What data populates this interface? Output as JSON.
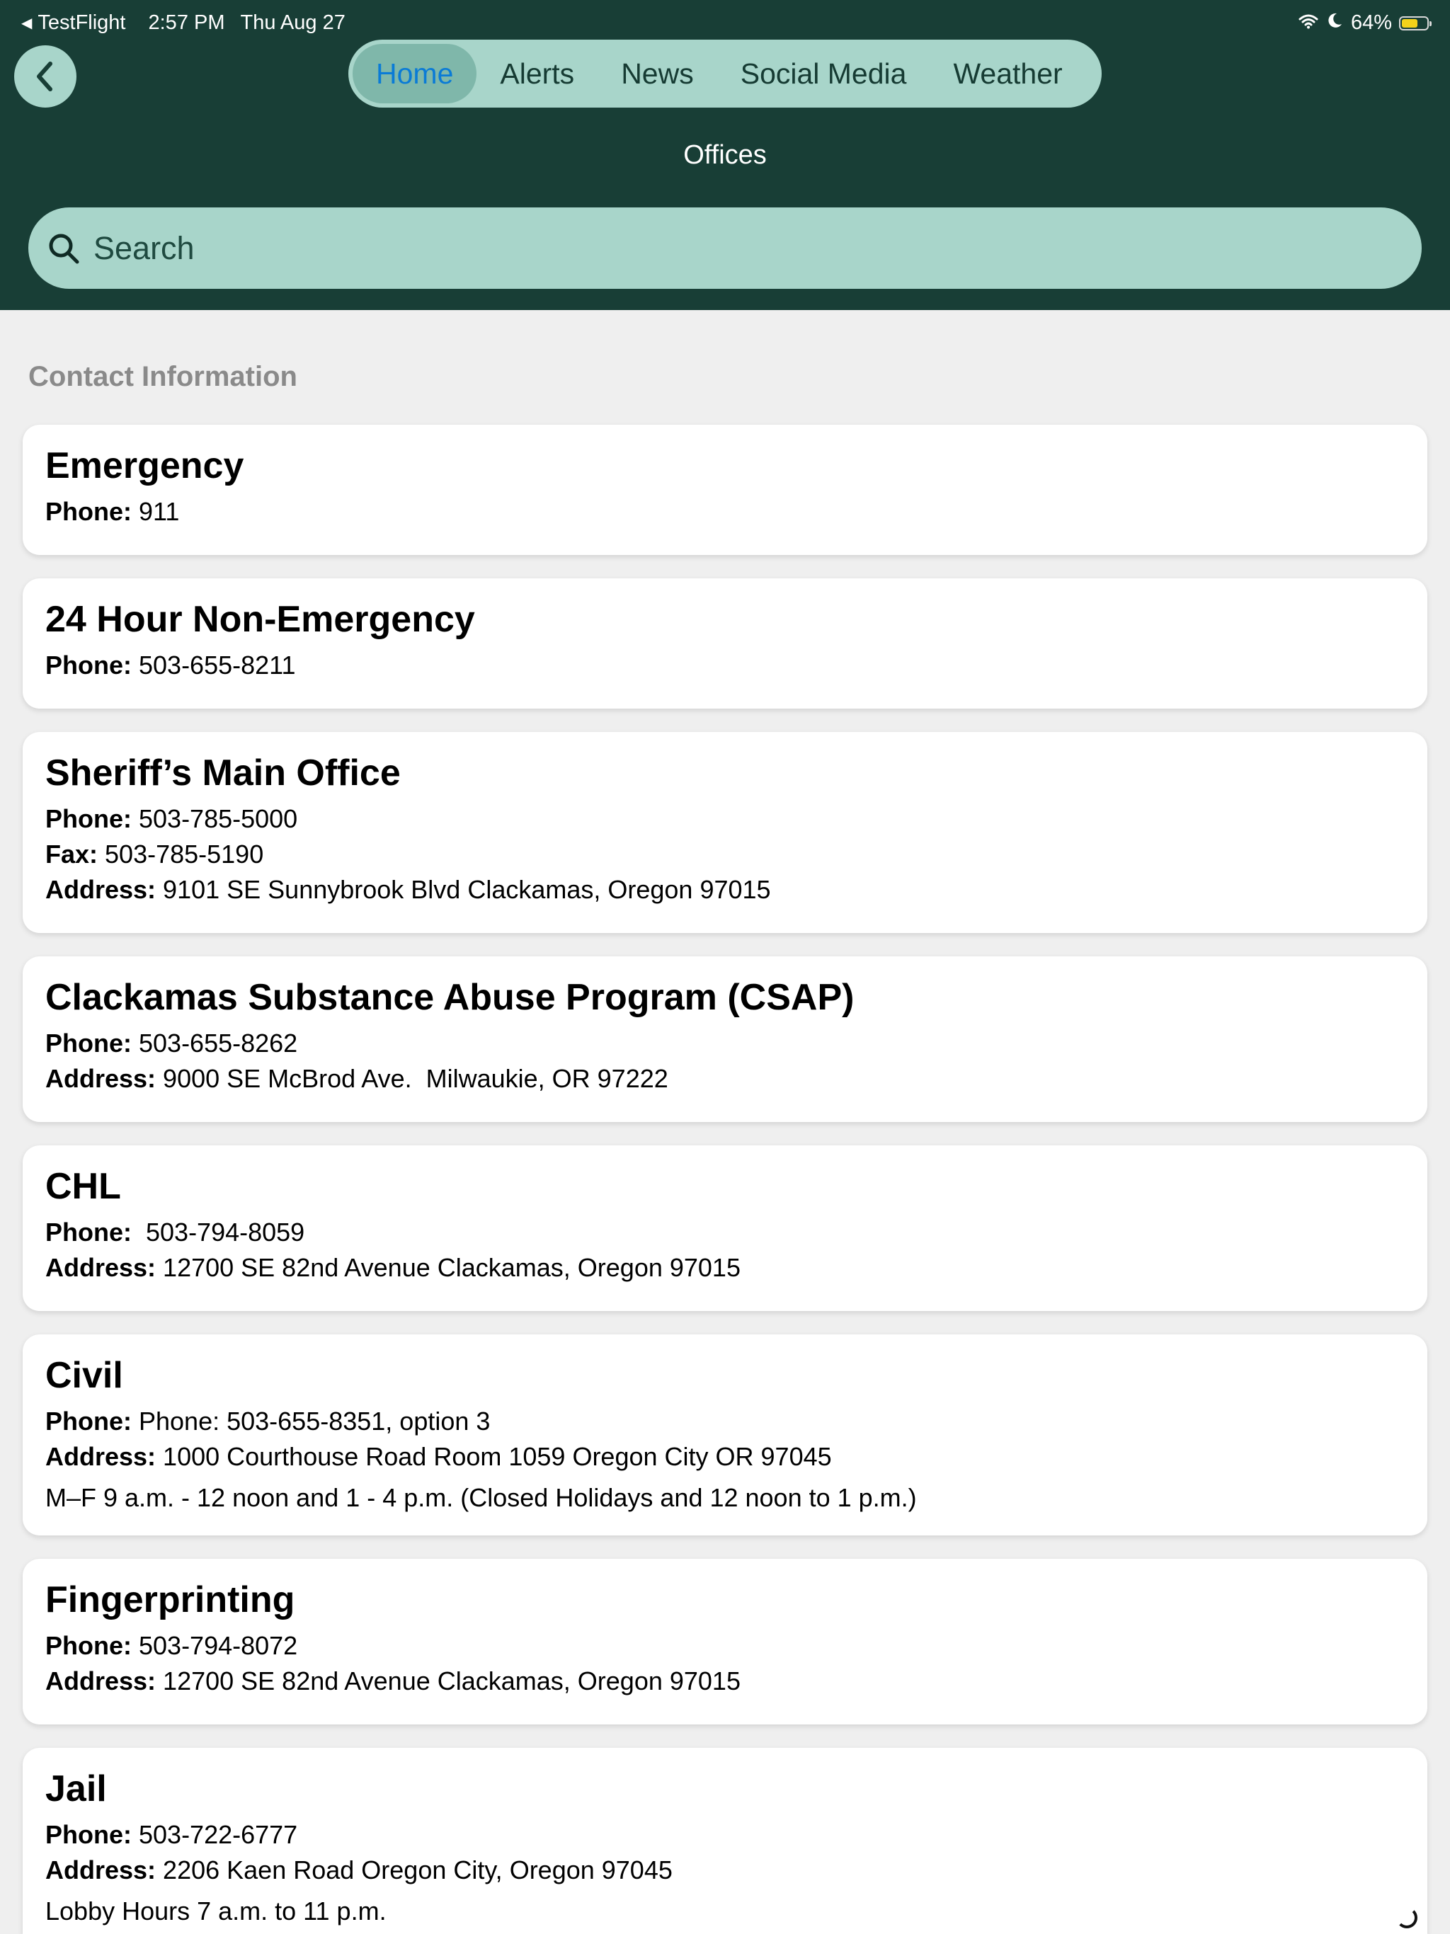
{
  "status_bar": {
    "app_back_label": "TestFlight",
    "time": "2:57 PM",
    "date": "Thu Aug 27",
    "battery_percent": "64%",
    "battery_level": 0.64
  },
  "nav": {
    "tabs": [
      {
        "label": "Home",
        "active": true
      },
      {
        "label": "Alerts",
        "active": false
      },
      {
        "label": "News",
        "active": false
      },
      {
        "label": "Social Media",
        "active": false
      },
      {
        "label": "Weather",
        "active": false
      }
    ],
    "title": "Offices"
  },
  "search": {
    "placeholder": "Search",
    "value": ""
  },
  "section": {
    "title": "Contact Information"
  },
  "labels": {
    "phone": "Phone:",
    "fax": "Fax:",
    "address": "Address:"
  },
  "contacts": [
    {
      "name": "Emergency",
      "phone": " 911"
    },
    {
      "name": "24 Hour Non-Emergency",
      "phone": " 503-655-8211"
    },
    {
      "name": "Sheriff’s Main Office",
      "phone": " 503-785-5000",
      "fax": " 503-785-5190",
      "address": " 9101 SE Sunnybrook Blvd Clackamas, Oregon 97015"
    },
    {
      "name": "Clackamas Substance Abuse Program (CSAP)",
      "phone": " 503-655-8262",
      "address": " 9000 SE McBrod Ave.  Milwaukie, OR 97222"
    },
    {
      "name": "CHL",
      "phone": "  503-794-8059",
      "address": " 12700 SE 82nd Avenue Clackamas, Oregon 97015"
    },
    {
      "name": "Civil",
      "phone": " Phone: 503-655-8351, option 3",
      "address": " 1000 Courthouse Road Room 1059 Oregon City OR 97045",
      "note": "M–F 9 a.m. - 12 noon and 1 - 4 p.m. (Closed Holidays and 12 noon to 1 p.m.)"
    },
    {
      "name": "Fingerprinting",
      "phone": " 503-794-8072",
      "address": " 12700 SE 82nd Avenue Clackamas, Oregon 97015"
    },
    {
      "name": "Jail",
      "phone": " 503-722-6777",
      "address": " 2206 Kaen Road Oregon City, Oregon 97045",
      "note": "Lobby Hours 7 a.m. to 11 p.m."
    }
  ]
}
